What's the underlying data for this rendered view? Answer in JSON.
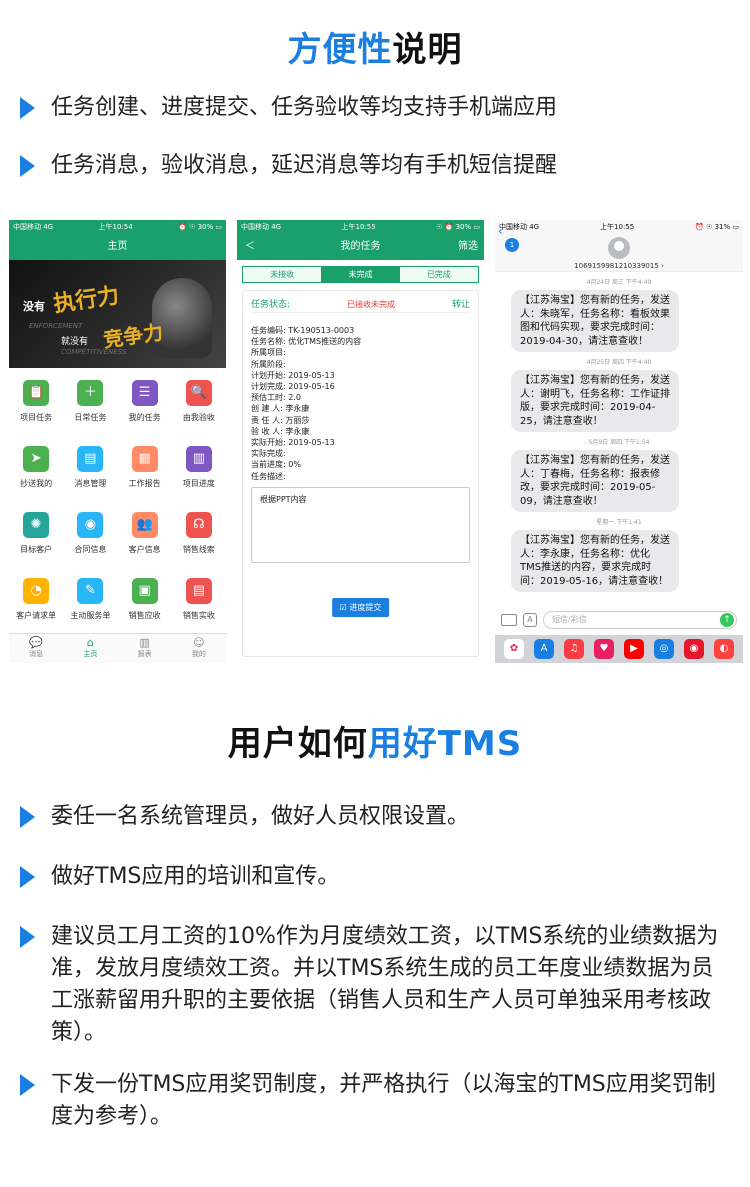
{
  "section1": {
    "title_accent": "方便性",
    "title_rest": "说明",
    "bullets": [
      "任务创建、进度提交、任务验收等均支持手机端应用",
      "任务消息，验收消息，延迟消息等均有手机短信提醒"
    ]
  },
  "phone1": {
    "status": {
      "carrier": "中国移动  4G",
      "time": "上午10:54",
      "battery": "⏰ ☉ 30% ▭"
    },
    "nav_title": "主页",
    "banner": {
      "l1": "没有",
      "l2": "执行力",
      "l3": "ENFORCEMENT",
      "l4": "就没有",
      "l5": "竞争力",
      "l6": "COMPETITIVENESS"
    },
    "grid": [
      {
        "label": "项目任务",
        "icon": "📋",
        "color": "#4caf50"
      },
      {
        "label": "日常任务",
        "icon": "＋",
        "color": "#4caf50"
      },
      {
        "label": "我的任务",
        "icon": "☰",
        "color": "#7e57c2"
      },
      {
        "label": "由我验收",
        "icon": "🔍",
        "color": "#ef5350"
      },
      {
        "label": "抄送我的",
        "icon": "➤",
        "color": "#4caf50"
      },
      {
        "label": "消息管理",
        "icon": "▤",
        "color": "#29b6f6"
      },
      {
        "label": "工作报告",
        "icon": "▦",
        "color": "#ff8a65"
      },
      {
        "label": "项目进度",
        "icon": "▥",
        "color": "#7e57c2"
      },
      {
        "label": "目标客户",
        "icon": "✺",
        "color": "#26a69a"
      },
      {
        "label": "合同信息",
        "icon": "◉",
        "color": "#29b6f6"
      },
      {
        "label": "客户信息",
        "icon": "👥",
        "color": "#ff8a65"
      },
      {
        "label": "销售线索",
        "icon": "☊",
        "color": "#ef5350"
      },
      {
        "label": "客户请求单",
        "icon": "◔",
        "color": "#ffb300"
      },
      {
        "label": "主动服务单",
        "icon": "✎",
        "color": "#29b6f6"
      },
      {
        "label": "销售应收",
        "icon": "▣",
        "color": "#4caf50"
      },
      {
        "label": "销售实收",
        "icon": "▤",
        "color": "#ef5350"
      }
    ],
    "tabs": [
      {
        "label": "消息",
        "icon": "💬"
      },
      {
        "label": "主页",
        "icon": "⌂"
      },
      {
        "label": "报表",
        "icon": "▥"
      },
      {
        "label": "我的",
        "icon": "☺"
      }
    ]
  },
  "phone2": {
    "status": {
      "carrier": "中国移动  4G",
      "time": "上午10:55",
      "battery": "☉ ⏰ 30% ▭"
    },
    "back": "＜",
    "nav_title": "我的任务",
    "filter": "筛选",
    "segments": [
      "未接收",
      "未完成",
      "已完成"
    ],
    "status_label": "任务状态:",
    "status_value": "已接收未完成",
    "transfer": "转让",
    "fields": [
      "任务编码:  TK-190513-0003",
      "任务名称:  优化TMS推送的内容",
      "所属项目:",
      "所属阶段:",
      "计划开始:  2019-05-13",
      "计划完成:  2019-05-16",
      "预估工时:  2.0",
      "创 建 人:  李永康",
      "责 任 人:  万丽莎",
      "验 收 人:  李永康",
      "实际开始:  2019-05-13",
      "实际完成:",
      "当前进度:  0%",
      "任务描述:"
    ],
    "description": "根据PPT内容",
    "submit": "☑ 进度提交"
  },
  "phone3": {
    "status": {
      "carrier": "中国移动  4G",
      "time": "上午10:55",
      "battery": "⏰ ☉ 31% ▭"
    },
    "back_badge": "1",
    "number": "1069159981210339015 ›",
    "messages": [
      {
        "date": "4月24日 周三 下午4:49",
        "text": "【江苏海宝】您有新的任务，发送人：朱晓军，任务名称：看板效果图和代码实现，要求完成时间：2019-04-30，请注意查收！"
      },
      {
        "date": "4月25日 周四 下午4:40",
        "text": "【江苏海宝】您有新的任务，发送人：谢明飞，任务名称：工作证排版，要求完成时间：2019-04-25，请注意查收！"
      },
      {
        "date": "5月9日 周四 下午1:54",
        "text": "【江苏海宝】您有新的任务，发送人：丁春梅，任务名称：报表修改，要求完成时间：2019-05-09，请注意查收！"
      },
      {
        "date": "星期一 下午1:41",
        "text": "【江苏海宝】您有新的任务，发送人：李永康，任务名称：优化TMS推送的内容，要求完成时间：2019-05-16，请注意查收！"
      }
    ],
    "input_placeholder": "短信/彩信",
    "tray": [
      {
        "icon": "✿",
        "color": "#ffffff"
      },
      {
        "icon": "A",
        "color": "#1a7fe0"
      },
      {
        "icon": "♫",
        "color": "#fc3c44"
      },
      {
        "icon": "♥",
        "color": "#e91e63"
      },
      {
        "icon": "▶",
        "color": "#ff0000"
      },
      {
        "icon": "◎",
        "color": "#1a7fe0"
      },
      {
        "icon": "◉",
        "color": "#e6162d"
      },
      {
        "icon": "◐",
        "color": "#ff4040"
      }
    ]
  },
  "section2": {
    "title_dark": "用户如何",
    "title_accent": "用好TMS",
    "bullets": [
      "委任一名系统管理员，做好人员权限设置。",
      "做好TMS应用的培训和宣传。",
      "建议员工月工资的10%作为月度绩效工资，以TMS系统的业绩数据为准，发放月度绩效工资。并以TMS系统生成的员工年度业绩数据为员工涨薪留用升职的主要依据（销售人员和生产人员可单独采用考核政策）。",
      "下发一份TMS应用奖罚制度，并严格执行（以海宝的TMS应用奖罚制度为参考）。"
    ]
  },
  "colors": {
    "accent": "#1a7fe0",
    "green": "#1aa16b"
  }
}
